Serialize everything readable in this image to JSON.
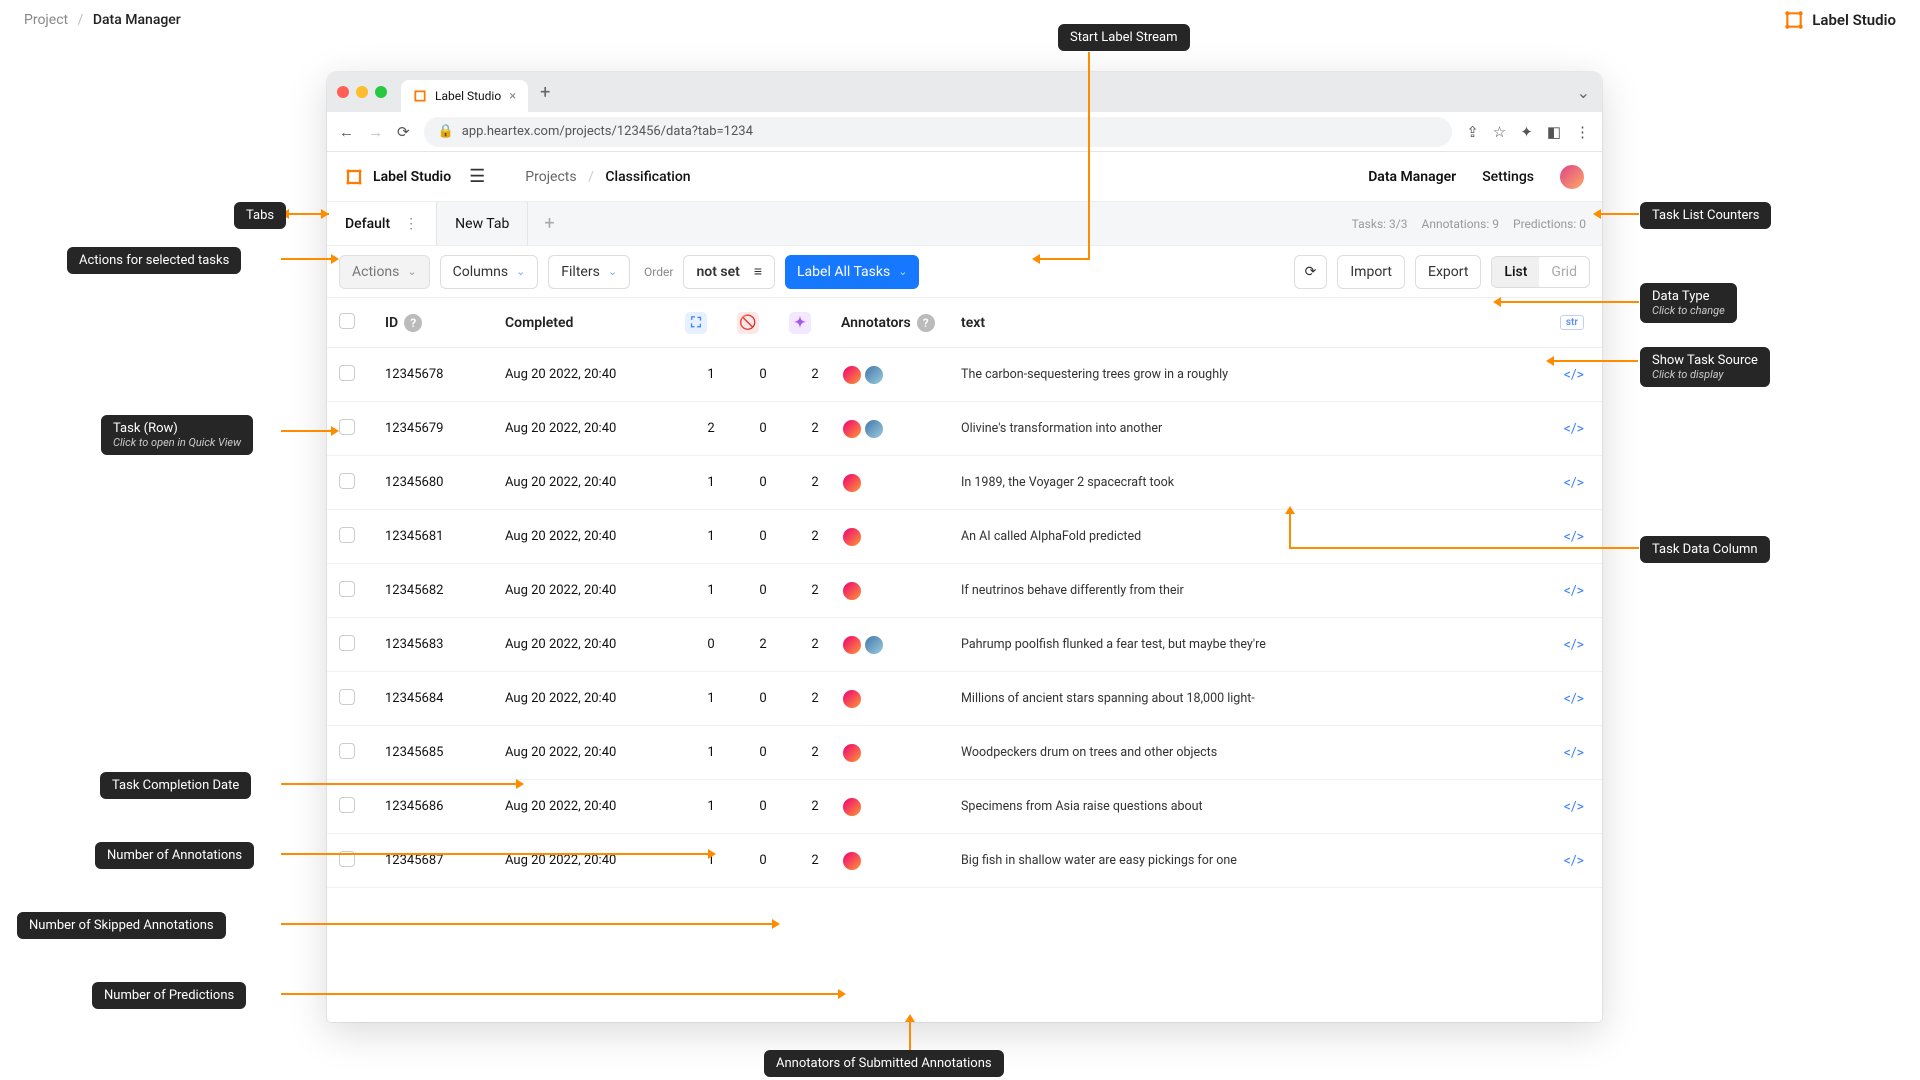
{
  "page_breadcrumb": {
    "root": "Project",
    "current": "Data Manager"
  },
  "brand": "Label Studio",
  "browser": {
    "tab_title": "Label Studio",
    "url": "app.heartex.com/projects/123456/data?tab=1234"
  },
  "app": {
    "title": "Label Studio",
    "crumb_root": "Projects",
    "crumb_current": "Classification",
    "nav_data_manager": "Data Manager",
    "nav_settings": "Settings"
  },
  "tabs": {
    "default": "Default",
    "new_tab": "New Tab"
  },
  "counters": {
    "tasks": "Tasks: 3/3",
    "annotations": "Annotations: 9",
    "predictions": "Predictions: 0"
  },
  "toolbar": {
    "actions": "Actions",
    "columns": "Columns",
    "filters": "Filters",
    "order_label": "Order",
    "order_value": "not set",
    "label_all": "Label All Tasks",
    "import": "Import",
    "export": "Export",
    "view_list": "List",
    "view_grid": "Grid"
  },
  "columns": {
    "id": "ID",
    "completed": "Completed",
    "annotators": "Annotators",
    "text": "text",
    "type_pill": "str"
  },
  "rows": [
    {
      "id": "12345678",
      "completed": "Aug 20 2022, 20:40",
      "ann": "1",
      "skip": "0",
      "pred": "2",
      "avatars": 2,
      "text": "The carbon-sequestering trees grow in a roughly"
    },
    {
      "id": "12345679",
      "completed": "Aug 20 2022, 20:40",
      "ann": "2",
      "skip": "0",
      "pred": "2",
      "avatars": 2,
      "text": "Olivine's transformation into another"
    },
    {
      "id": "12345680",
      "completed": "Aug 20 2022, 20:40",
      "ann": "1",
      "skip": "0",
      "pred": "2",
      "avatars": 1,
      "text": "In 1989, the Voyager 2 spacecraft took"
    },
    {
      "id": "12345681",
      "completed": "Aug 20 2022, 20:40",
      "ann": "1",
      "skip": "0",
      "pred": "2",
      "avatars": 1,
      "text": "An AI called AlphaFold predicted"
    },
    {
      "id": "12345682",
      "completed": "Aug 20 2022, 20:40",
      "ann": "1",
      "skip": "0",
      "pred": "2",
      "avatars": 1,
      "text": "If neutrinos behave differently from their"
    },
    {
      "id": "12345683",
      "completed": "Aug 20 2022, 20:40",
      "ann": "0",
      "skip": "2",
      "pred": "2",
      "avatars": 2,
      "text": "Pahrump poolfish flunked a fear test, but maybe they're"
    },
    {
      "id": "12345684",
      "completed": "Aug 20 2022, 20:40",
      "ann": "1",
      "skip": "0",
      "pred": "2",
      "avatars": 1,
      "text": "Millions of ancient stars spanning about 18,000 light-"
    },
    {
      "id": "12345685",
      "completed": "Aug 20 2022, 20:40",
      "ann": "1",
      "skip": "0",
      "pred": "2",
      "avatars": 1,
      "text": "Woodpeckers drum on trees and other objects"
    },
    {
      "id": "12345686",
      "completed": "Aug 20 2022, 20:40",
      "ann": "1",
      "skip": "0",
      "pred": "2",
      "avatars": 1,
      "text": "Specimens from Asia raise questions about"
    },
    {
      "id": "12345687",
      "completed": "Aug 20 2022, 20:40",
      "ann": "1",
      "skip": "0",
      "pred": "2",
      "avatars": 1,
      "text": "Big fish in shallow water are easy pickings for one"
    }
  ],
  "callouts": {
    "start_label": "Start Label Stream",
    "tabs": "Tabs",
    "actions": "Actions for selected tasks",
    "task_row_t": "Task (Row)",
    "task_row_s": "Click to open in Quick View",
    "counters": "Task List Counters",
    "data_type_t": "Data Type",
    "data_type_s": "Click to change",
    "show_src_t": "Show Task Source",
    "show_src_s": "Click to display",
    "task_data_col": "Task Data Column",
    "completion": "Task Completion Date",
    "num_ann": "Number of Annotations",
    "num_skip": "Number of Skipped Annotations",
    "num_pred": "Number of Predictions",
    "annotators": "Annotators of Submitted Annotations"
  }
}
